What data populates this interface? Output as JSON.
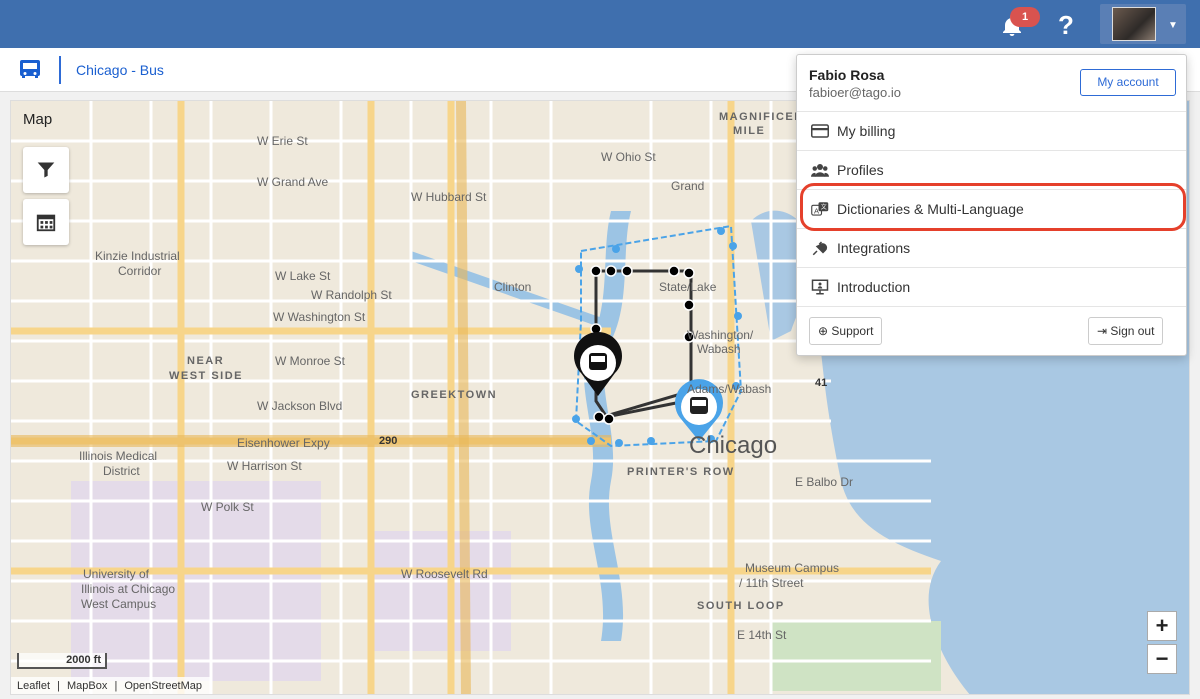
{
  "topbar": {
    "notification_count": "1",
    "help_label": "?"
  },
  "subbar": {
    "dashboard_title": "Chicago - Bus"
  },
  "map": {
    "label": "Map",
    "scale_label": "2000 ft",
    "attribution": [
      "Leaflet",
      "|",
      "MapBox",
      "|",
      "OpenStreetMap"
    ],
    "zoom_in": "+",
    "zoom_out": "−",
    "place_labels": [
      "MAGNIFICENT",
      "MILE",
      "W Erie St",
      "W Ohio St",
      "Grand",
      "W Grand Ave",
      "W Hubbard St",
      "Kinzie Industrial",
      "Corridor",
      "W Lake St",
      "W Randolph St",
      "W Washington St",
      "Clinton",
      "State/Lake",
      "NEAR",
      "WEST SIDE",
      "W Monroe St",
      "GREEKTOWN",
      "W Jackson Blvd",
      "Eisenhower Expy",
      "290",
      "Illinois Medical",
      "District",
      "W Harrison St",
      "PRINTER'S ROW",
      "Chicago",
      "W Polk St",
      "University of",
      "Illinois at Chicago",
      "West Campus",
      "W Roosevelt Rd",
      "Museum Campus",
      "/ 11th Street",
      "SOUTH LOOP",
      "E 14th St",
      "41",
      "E Balbo Dr",
      "Adams/Wabash",
      "Washington/",
      "Wabash"
    ]
  },
  "user_menu": {
    "name": "Fabio Rosa",
    "email": "fabioer@tago.io",
    "my_account": "My account",
    "items": [
      {
        "label": "My billing",
        "icon": "credit-card-icon"
      },
      {
        "label": "Profiles",
        "icon": "users-icon"
      },
      {
        "label": "Dictionaries & Multi-Language",
        "icon": "translate-icon"
      },
      {
        "label": "Integrations",
        "icon": "plug-icon"
      },
      {
        "label": "Introduction",
        "icon": "presentation-icon"
      }
    ],
    "support": "Support",
    "sign_out": "Sign out"
  },
  "colors": {
    "topbar": "#3f6fae",
    "accent": "#2e6bd6",
    "highlight": "#e5402b",
    "route": "#4aa3e8"
  }
}
